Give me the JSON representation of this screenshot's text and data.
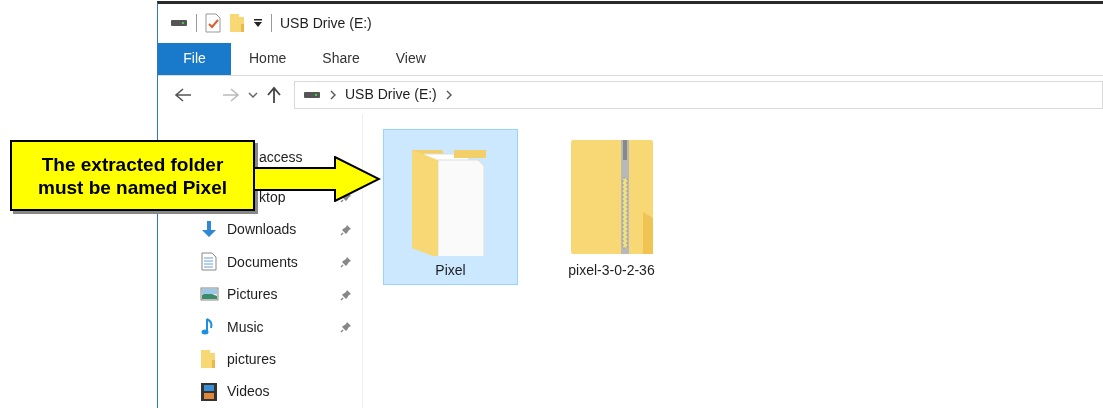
{
  "window": {
    "title": "USB Drive (E:)"
  },
  "ribbon_tabs": [
    {
      "label": "File",
      "selected": true
    },
    {
      "label": "Home",
      "selected": false
    },
    {
      "label": "Share",
      "selected": false
    },
    {
      "label": "View",
      "selected": false
    }
  ],
  "address": {
    "path": [
      "USB Drive (E:)"
    ]
  },
  "navigation": [
    {
      "label": "access",
      "pinned": false
    },
    {
      "label": "ktop",
      "pinned": true
    },
    {
      "label": "Downloads",
      "kind": "downloads",
      "pinned": true
    },
    {
      "label": "Documents",
      "kind": "documents",
      "pinned": true
    },
    {
      "label": "Pictures",
      "kind": "pictures",
      "pinned": true
    },
    {
      "label": "Music",
      "kind": "music",
      "pinned": true
    },
    {
      "label": "pictures",
      "kind": "folder",
      "pinned": false
    },
    {
      "label": "Videos",
      "kind": "videos",
      "pinned": false
    }
  ],
  "files": [
    {
      "label": "Pixel",
      "kind": "folder",
      "selected": true
    },
    {
      "label": "pixel-3-0-2-36",
      "kind": "zip",
      "selected": false
    }
  ],
  "callout": {
    "text": "The extracted folder\nmust be named Pixel"
  }
}
